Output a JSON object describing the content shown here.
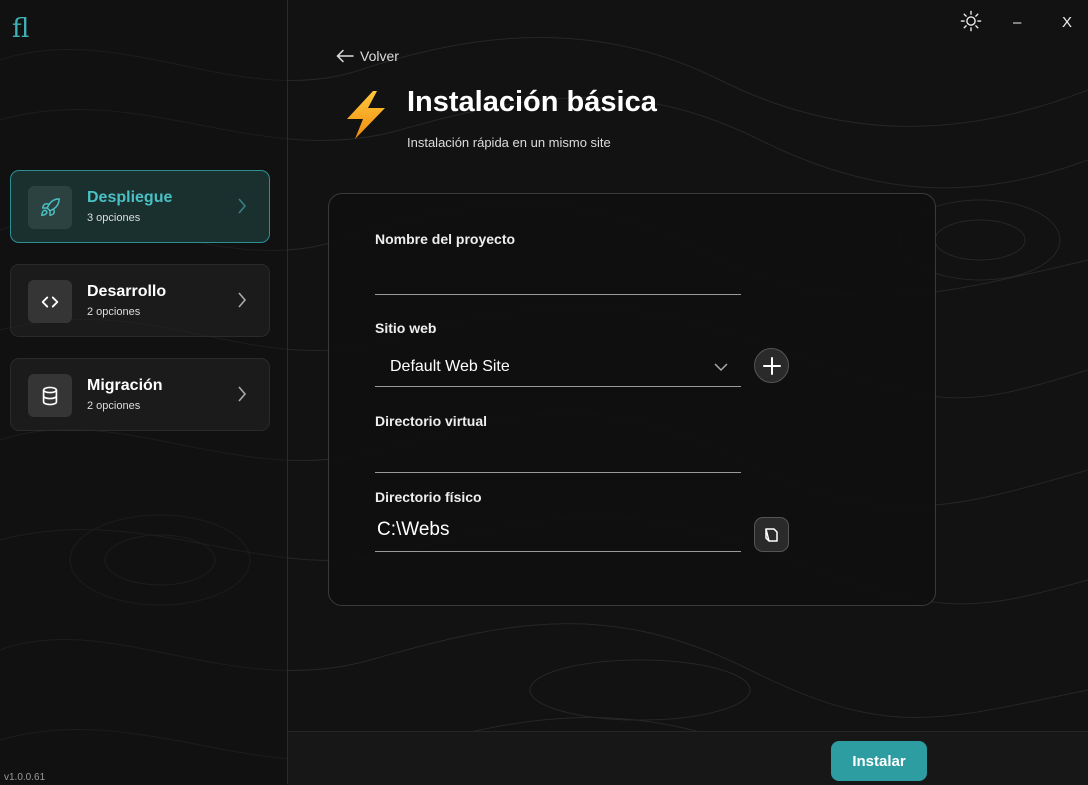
{
  "app": {
    "logo": "fl",
    "version": "v1.0.0.61"
  },
  "window": {
    "theme_icon": "sun-icon",
    "minimize_label": "–",
    "close_label": "X"
  },
  "sidebar": {
    "items": [
      {
        "title": "Despliegue",
        "subtitle": "3 opciones",
        "icon": "rocket-icon",
        "active": true
      },
      {
        "title": "Desarrollo",
        "subtitle": "2 opciones",
        "icon": "code-icon",
        "active": false
      },
      {
        "title": "Migración",
        "subtitle": "2 opciones",
        "icon": "database-icon",
        "active": false
      }
    ]
  },
  "header": {
    "back_label": "Volver",
    "icon": "lightning-icon",
    "title": "Instalación básica",
    "subtitle": "Instalación rápida en un mismo site"
  },
  "form": {
    "project_name": {
      "label": "Nombre del proyecto",
      "value": ""
    },
    "website": {
      "label": "Sitio web",
      "value": "Default Web Site",
      "add_icon": "plus-icon"
    },
    "virtual_dir": {
      "label": "Directorio virtual",
      "value": ""
    },
    "physical_dir": {
      "label": "Directorio físico",
      "value": "C:\\Webs",
      "browse_icon": "folder-icon"
    }
  },
  "footer": {
    "install_label": "Instalar"
  },
  "colors": {
    "accent": "#2d9da2",
    "accent_text": "#4bc0c4",
    "background": "#121212",
    "bolt": "#f5a623"
  }
}
